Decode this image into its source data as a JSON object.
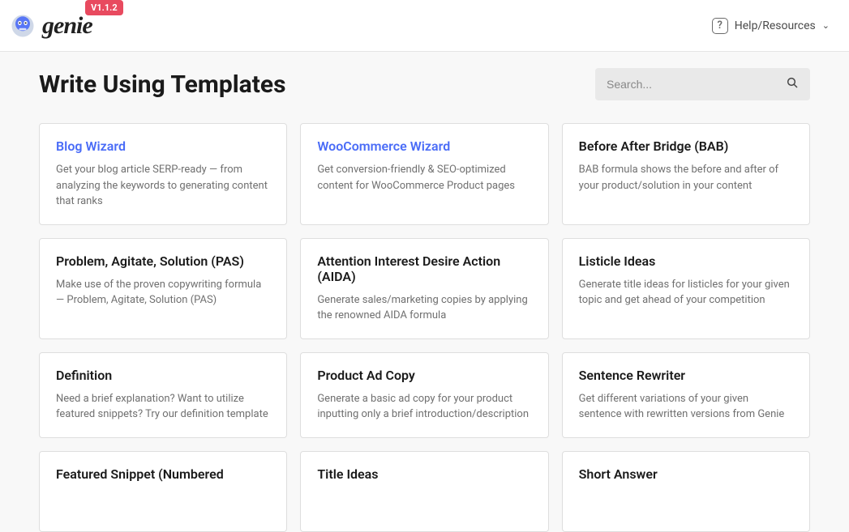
{
  "header": {
    "logo_text": "genie",
    "version": "V1.1.2",
    "help_label": "Help/Resources"
  },
  "page": {
    "title": "Write Using Templates",
    "search_placeholder": "Search..."
  },
  "templates": [
    {
      "title": "Blog Wizard",
      "accent": true,
      "desc": "Get your blog article SERP-ready — from analyzing the keywords to generating content that ranks"
    },
    {
      "title": "WooCommerce Wizard",
      "accent": true,
      "desc": "Get conversion-friendly & SEO-optimized content for WooCommerce Product pages"
    },
    {
      "title": "Before After Bridge (BAB)",
      "accent": false,
      "desc": "BAB formula shows the before and after of your product/solution in your content"
    },
    {
      "title": "Problem, Agitate, Solution (PAS)",
      "accent": false,
      "desc": "Make use of the proven copywriting formula — Problem, Agitate, Solution (PAS)"
    },
    {
      "title": "Attention Interest Desire Action (AIDA)",
      "accent": false,
      "desc": "Generate sales/marketing copies by applying the renowned AIDA formula"
    },
    {
      "title": "Listicle Ideas",
      "accent": false,
      "desc": "Generate title ideas for listicles for your given topic and get ahead of your competition"
    },
    {
      "title": "Definition",
      "accent": false,
      "desc": "Need a brief explanation? Want to utilize featured snippets? Try our definition template"
    },
    {
      "title": "Product Ad Copy",
      "accent": false,
      "desc": "Generate a basic ad copy for your product inputting only a brief introduction/description"
    },
    {
      "title": "Sentence Rewriter",
      "accent": false,
      "desc": "Get different variations of your given sentence with rewritten versions from Genie"
    },
    {
      "title": "Featured Snippet (Numbered",
      "accent": false,
      "desc": ""
    },
    {
      "title": "Title Ideas",
      "accent": false,
      "desc": ""
    },
    {
      "title": "Short Answer",
      "accent": false,
      "desc": ""
    }
  ]
}
